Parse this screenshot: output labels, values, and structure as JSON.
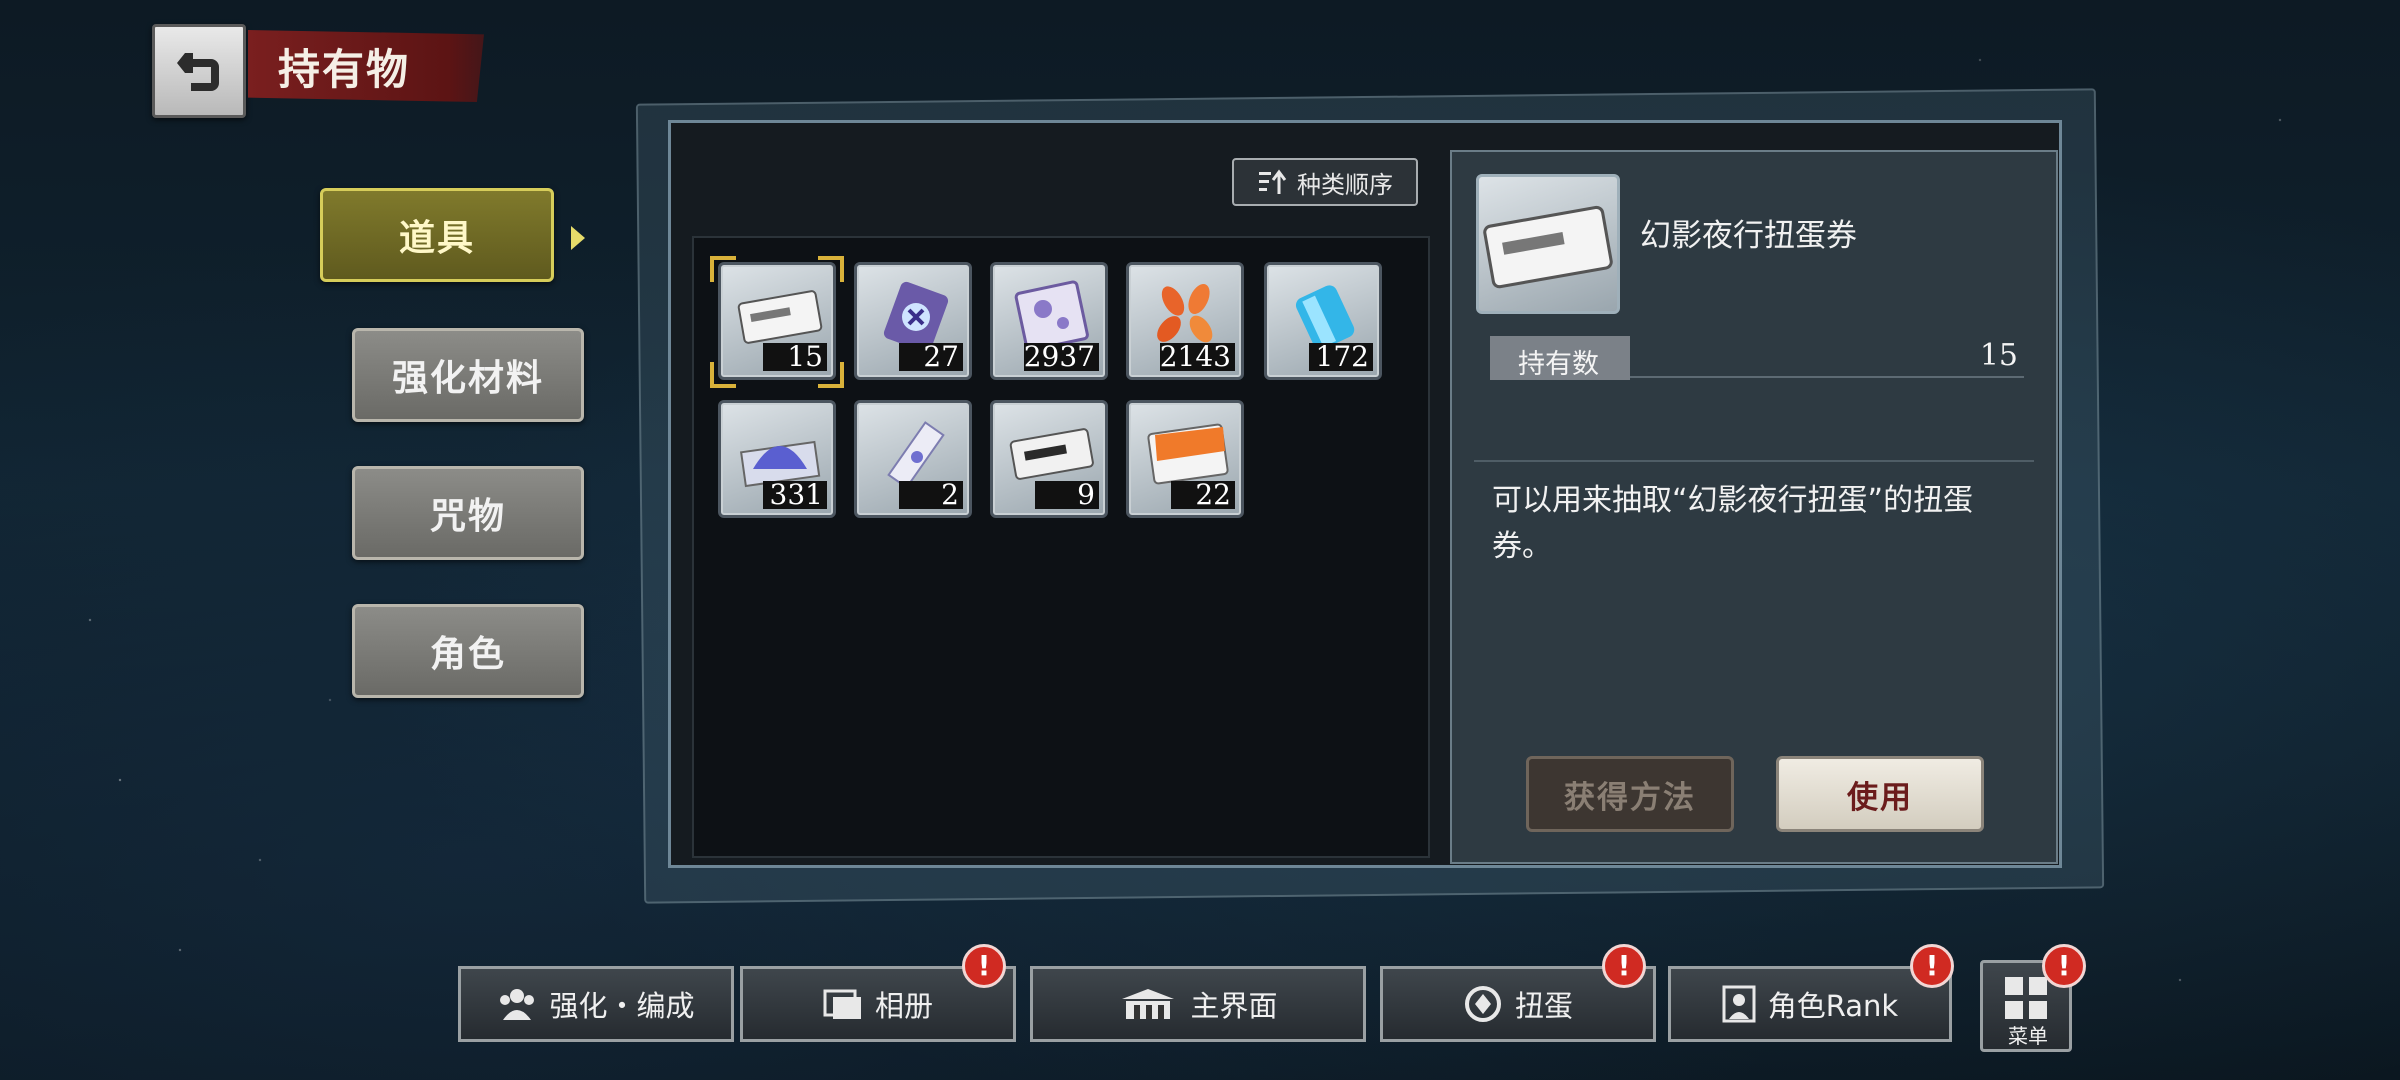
{
  "header": {
    "title": "持有物"
  },
  "tabs": [
    {
      "label": "道具",
      "active": true
    },
    {
      "label": "强化材料",
      "active": false
    },
    {
      "label": "咒物",
      "active": false
    },
    {
      "label": "角色",
      "active": false
    }
  ],
  "toolbar": {
    "sort_label": "种类顺序"
  },
  "items": [
    {
      "icon": "gacha-ticket-icon",
      "count": "15",
      "selected": true
    },
    {
      "icon": "charm-tag-icon",
      "count": "27"
    },
    {
      "icon": "crystal-sheet-icon",
      "count": "2937"
    },
    {
      "icon": "petals-icon",
      "count": "2143"
    },
    {
      "icon": "blue-scroll-icon",
      "count": "172"
    },
    {
      "icon": "blue-powder-icon",
      "count": "331"
    },
    {
      "icon": "talisman-icon",
      "count": "2"
    },
    {
      "icon": "silver-ticket-icon",
      "count": "9"
    },
    {
      "icon": "orange-card-icon",
      "count": "22"
    }
  ],
  "detail": {
    "name": "幻影夜行扭蛋券",
    "owned_label": "持有数",
    "owned_value": "15",
    "description": "可以用来抽取“幻影夜行扭蛋”的扭蛋券。",
    "acquire_label": "获得方法",
    "use_label": "使用"
  },
  "nav": {
    "enhance": "强化・编成",
    "album": "相册",
    "home": "主界面",
    "gacha": "扭蛋",
    "rank": "角色Rank",
    "menu": "菜单",
    "badge": "!"
  },
  "colors": {
    "accent_gold": "#d9b23a",
    "banner_red": "#7a1f1f",
    "badge_red": "#d02a22",
    "use_text": "#6b1c1c"
  }
}
